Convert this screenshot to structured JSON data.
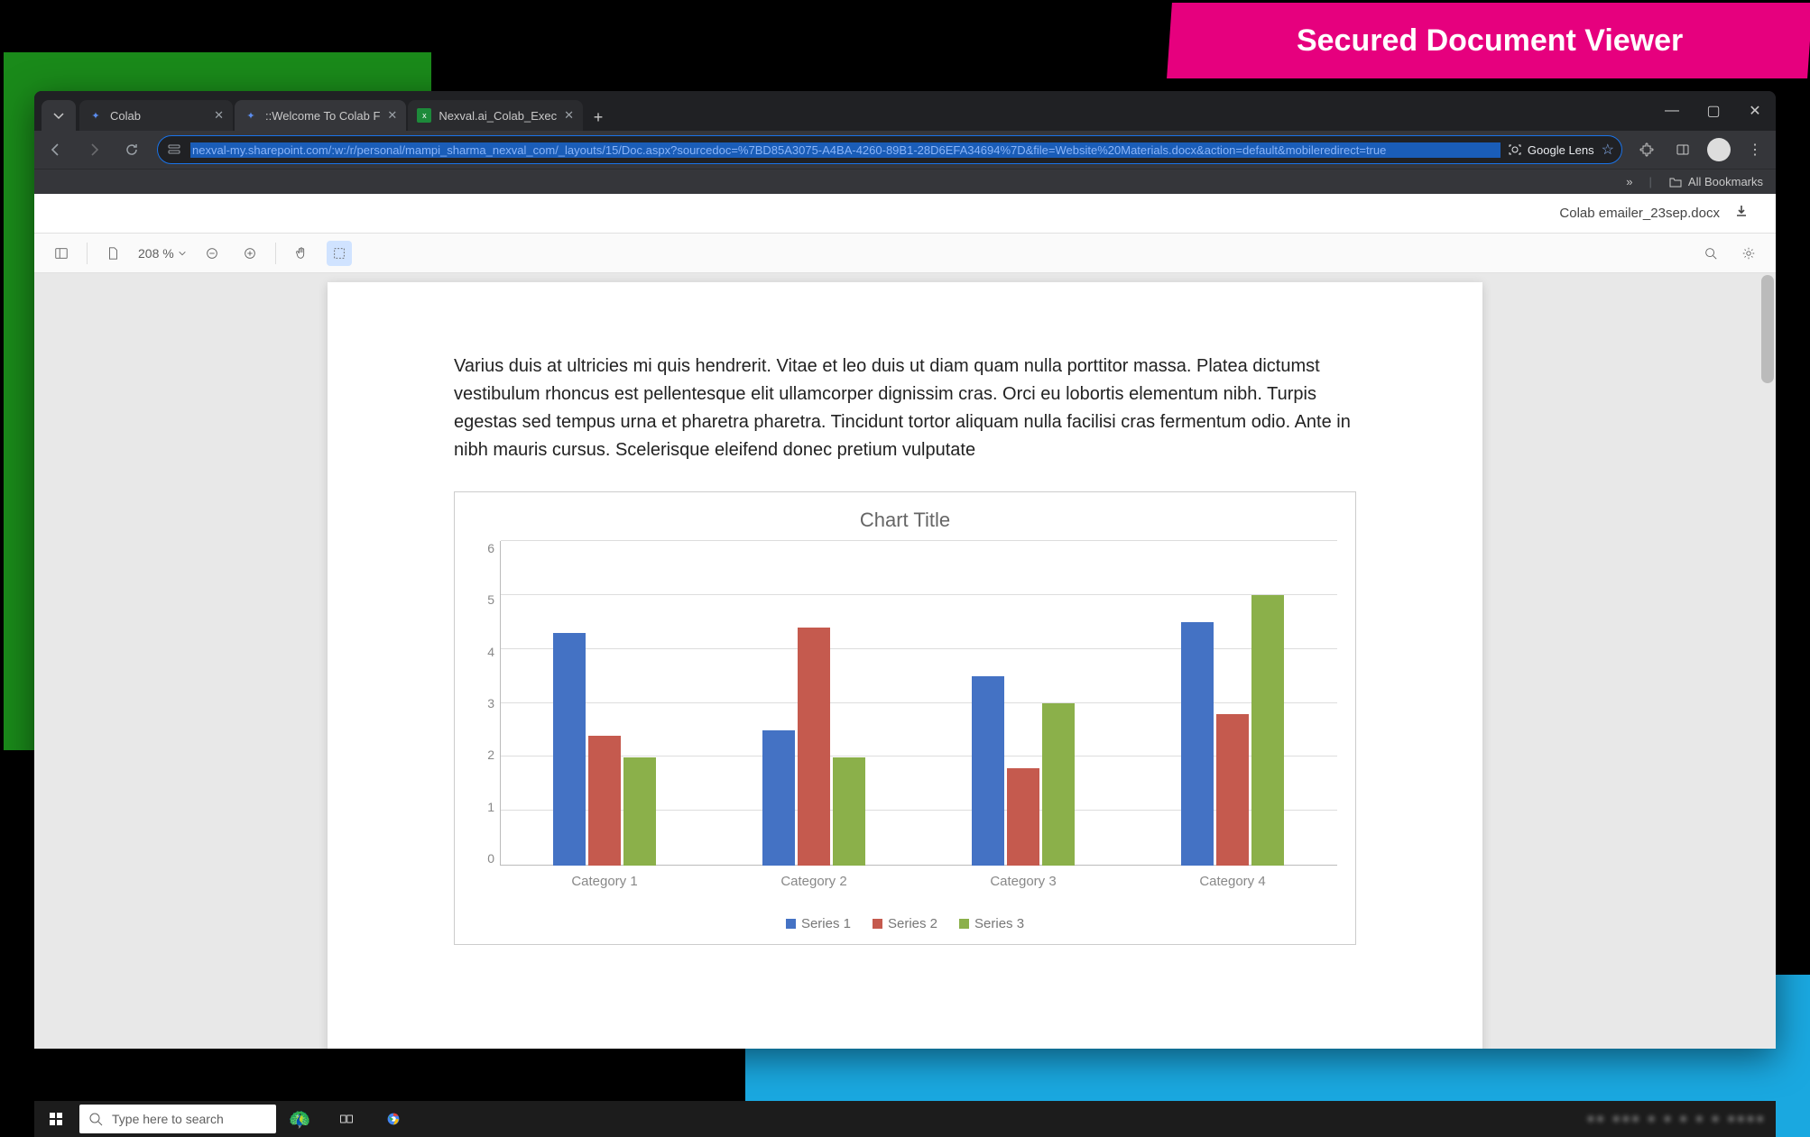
{
  "banner": {
    "title": "Secured Document Viewer"
  },
  "browser": {
    "tabs": [
      {
        "title": "Colab",
        "color": "#5b8def"
      },
      {
        "title": "::Welcome To Colab F",
        "color": "#5b8def"
      },
      {
        "title": "Nexval.ai_Colab_Exec",
        "color": "#1d8a3a"
      }
    ],
    "url": "nexval-my.sharepoint.com/:w:/r/personal/mampi_sharma_nexval_com/_layouts/15/Doc.aspx?sourcedoc=%7BD85A3075-A4BA-4260-89B1-28D6EFA34694%7D&file=Website%20Materials.docx&action=default&mobileredirect=true",
    "lens_label": "Google Lens",
    "all_bookmarks": "All Bookmarks"
  },
  "viewer": {
    "filename": "Colab emailer_23sep.docx",
    "zoom": "208 %"
  },
  "document": {
    "paragraph": "Varius duis at ultricies mi quis hendrerit. Vitae et leo duis ut diam quam nulla porttitor massa. Platea dictumst vestibulum rhoncus est pellentesque elit ullamcorper dignissim cras. Orci eu lobortis elementum nibh. Turpis egestas sed tempus urna et pharetra pharetra. Tincidunt tortor aliquam nulla facilisi cras fermentum odio. Ante in nibh mauris cursus. Scelerisque eleifend donec pretium vulputate"
  },
  "chart_data": {
    "type": "bar",
    "title": "Chart Title",
    "categories": [
      "Category 1",
      "Category 2",
      "Category 3",
      "Category 4"
    ],
    "series": [
      {
        "name": "Series 1",
        "color": "#4472c4",
        "values": [
          4.3,
          2.5,
          3.5,
          4.5
        ]
      },
      {
        "name": "Series 2",
        "color": "#c55a4e",
        "values": [
          2.4,
          4.4,
          1.8,
          2.8
        ]
      },
      {
        "name": "Series 3",
        "color": "#8bb04a",
        "values": [
          2.0,
          2.0,
          3.0,
          5.0
        ]
      }
    ],
    "ylim": [
      0,
      6
    ],
    "yticks": [
      0,
      1,
      2,
      3,
      4,
      5,
      6
    ]
  },
  "taskbar": {
    "search_placeholder": "Type here to search"
  }
}
